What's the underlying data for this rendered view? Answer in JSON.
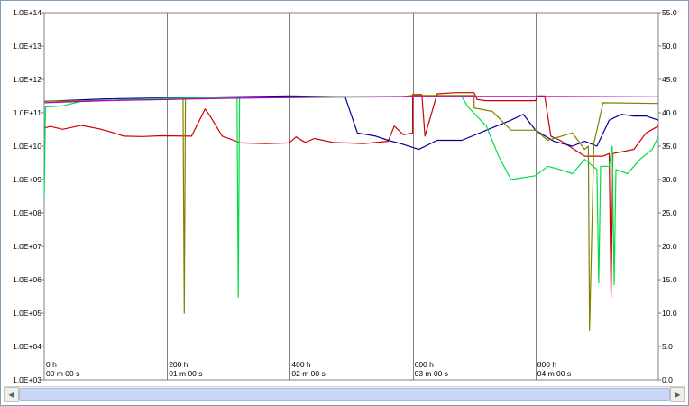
{
  "chart_data": {
    "type": "line",
    "left_axis": {
      "scale": "log",
      "ticks": [
        "1.0E+03",
        "1.0E+04",
        "1.0E+05",
        "1.0E+06",
        "1.0E+07",
        "1.0E+08",
        "1.0E+09",
        "1.0E+10",
        "1.0E+11",
        "1.0E+12",
        "1.0E+13",
        "1.0E+14"
      ],
      "range": [
        1000,
        100000000000000
      ]
    },
    "right_axis": {
      "scale": "linear",
      "ticks": [
        "0.0",
        "5.0",
        "10.0",
        "15.0",
        "20.0",
        "25.0",
        "30.0",
        "35.0",
        "40.0",
        "45.0",
        "50.0",
        "55.0"
      ],
      "range": [
        0,
        55
      ]
    },
    "x_axis": {
      "range": [
        0,
        1000
      ],
      "gridlines_at": [
        0,
        200,
        400,
        600,
        800
      ],
      "tick_labels": [
        {
          "x": 0,
          "hours": "0 h",
          "time": "00 m 00 s"
        },
        {
          "x": 200,
          "hours": "200 h",
          "time": "01 m 00 s"
        },
        {
          "x": 400,
          "hours": "400 h",
          "time": "02 m 00 s"
        },
        {
          "x": 600,
          "hours": "600 h",
          "time": "03 m 00 s"
        },
        {
          "x": 800,
          "hours": "800 h",
          "time": "04 m 00 s"
        }
      ]
    },
    "grid": "vertical-only",
    "series": [
      {
        "color": "#cc0000",
        "axis": "left",
        "points": [
          [
            0,
            35000000000.0
          ],
          [
            10,
            39000000000.0
          ],
          [
            30,
            32000000000.0
          ],
          [
            60,
            42000000000.0
          ],
          [
            90,
            33000000000.0
          ],
          [
            110,
            26000000000.0
          ],
          [
            130,
            20000000000.0
          ],
          [
            160,
            19500000000.0
          ],
          [
            190,
            20500000000.0
          ],
          [
            240,
            20000000000.0
          ],
          [
            262,
            130000000000.0
          ],
          [
            270,
            80000000000.0
          ],
          [
            290,
            20000000000.0
          ],
          [
            320,
            12500000000.0
          ],
          [
            360,
            12000000000.0
          ],
          [
            399,
            12500000000.0
          ],
          [
            410,
            19000000000.0
          ],
          [
            425,
            13000000000.0
          ],
          [
            440,
            17000000000.0
          ],
          [
            470,
            13000000000.0
          ],
          [
            520,
            12000000000.0
          ],
          [
            560,
            14000000000.0
          ],
          [
            570,
            40000000000.0
          ],
          [
            585,
            22000000000.0
          ],
          [
            600,
            25000000000.0
          ],
          [
            600,
            350000000000.0
          ],
          [
            615,
            350000000000.0
          ],
          [
            620,
            20000000000.0
          ],
          [
            640,
            370000000000.0
          ],
          [
            670,
            400000000000.0
          ],
          [
            700,
            400000000000.0
          ],
          [
            705,
            250000000000.0
          ],
          [
            720,
            230000000000.0
          ],
          [
            800,
            230000000000.0
          ],
          [
            803,
            320000000000.0
          ],
          [
            815,
            320000000000.0
          ],
          [
            825,
            20000000000.0
          ],
          [
            840,
            15000000000.0
          ],
          [
            880,
            5000000000.0
          ],
          [
            910,
            5000000000.0
          ],
          [
            920,
            6000000000.0
          ],
          [
            923,
            300000.0
          ],
          [
            926,
            6000000000.0
          ],
          [
            960,
            8000000000.0
          ],
          [
            980,
            25000000000.0
          ],
          [
            1000,
            40000000000.0
          ]
        ]
      },
      {
        "color": "#000099",
        "axis": "left",
        "points": [
          [
            0,
            220000000000.0
          ],
          [
            100,
            260000000000.0
          ],
          [
            300,
            300000000000.0
          ],
          [
            400,
            320000000000.0
          ],
          [
            490,
            300000000000.0
          ],
          [
            510,
            25000000000.0
          ],
          [
            540,
            20000000000.0
          ],
          [
            560,
            15000000000.0
          ],
          [
            580,
            12000000000.0
          ],
          [
            610,
            8000000000.0
          ],
          [
            640,
            15000000000.0
          ],
          [
            680,
            15000000000.0
          ],
          [
            720,
            30000000000.0
          ],
          [
            760,
            60000000000.0
          ],
          [
            780,
            90000000000.0
          ],
          [
            800,
            30000000000.0
          ],
          [
            830,
            14000000000.0
          ],
          [
            860,
            10000000000.0
          ],
          [
            880,
            14000000000.0
          ],
          [
            900,
            10000000000.0
          ],
          [
            920,
            60000000000.0
          ],
          [
            940,
            90000000000.0
          ],
          [
            960,
            80000000000.0
          ],
          [
            980,
            80000000000.0
          ],
          [
            1000,
            60000000000.0
          ]
        ]
      },
      {
        "color": "#808000",
        "axis": "left",
        "points": [
          [
            0,
            220000000000.0
          ],
          [
            200,
            250000000000.0
          ],
          [
            226,
            260000000000.0
          ],
          [
            228,
            100000.0
          ],
          [
            230,
            270000000000.0
          ],
          [
            400,
            300000000000.0
          ],
          [
            580,
            300000000000.0
          ],
          [
            600,
            330000000000.0
          ],
          [
            700,
            330000000000.0
          ],
          [
            700,
            140000000000.0
          ],
          [
            730,
            110000000000.0
          ],
          [
            760,
            30000000000.0
          ],
          [
            800,
            30000000000.0
          ],
          [
            820,
            15000000000.0
          ],
          [
            860,
            25000000000.0
          ],
          [
            880,
            8000000000.0
          ],
          [
            886,
            10000000000.0
          ],
          [
            888,
            30000.0
          ],
          [
            895,
            12000000000.0
          ],
          [
            910,
            200000000000.0
          ],
          [
            1000,
            190000000000.0
          ]
        ]
      },
      {
        "color": "#00dd44",
        "axis": "left",
        "points": [
          [
            0,
            300000000.0
          ],
          [
            2,
            150000000000.0
          ],
          [
            30,
            160000000000.0
          ],
          [
            60,
            220000000000.0
          ],
          [
            200,
            270000000000.0
          ],
          [
            314,
            280000000000.0
          ],
          [
            316,
            300000.0
          ],
          [
            318,
            280000000000.0
          ],
          [
            600,
            300000000000.0
          ],
          [
            680,
            300000000000.0
          ],
          [
            690,
            150000000000.0
          ],
          [
            720,
            40000000000.0
          ],
          [
            740,
            5000000000.0
          ],
          [
            760,
            1000000000.0
          ],
          [
            800,
            1300000000.0
          ],
          [
            820,
            2500000000.0
          ],
          [
            840,
            2000000000.0
          ],
          [
            860,
            1500000000.0
          ],
          [
            880,
            4000000000.0
          ],
          [
            900,
            2000000000.0
          ],
          [
            903,
            800000.0
          ],
          [
            906,
            2500000000.0
          ],
          [
            920,
            2500000000.0
          ],
          [
            925,
            10000000000.0
          ],
          [
            928,
            700000.0
          ],
          [
            931,
            2000000000.0
          ],
          [
            950,
            1500000000.0
          ],
          [
            970,
            4000000000.0
          ],
          [
            990,
            8000000000.0
          ],
          [
            1000,
            20000000000.0
          ]
        ]
      },
      {
        "color": "#bb00bb",
        "axis": "left",
        "points": [
          [
            0,
            200000000000.0
          ],
          [
            100,
            230000000000.0
          ],
          [
            300,
            270000000000.0
          ],
          [
            500,
            300000000000.0
          ],
          [
            600,
            310000000000.0
          ],
          [
            800,
            310000000000.0
          ],
          [
            1000,
            300000000000.0
          ]
        ]
      }
    ]
  },
  "scrollbar": {
    "left_icon": "scroll-left-arrow-icon",
    "right_icon": "scroll-right-arrow-icon",
    "left_glyph": "◀",
    "right_glyph": "▶"
  },
  "colors": {
    "plot_background": "#ffffff",
    "gridline": "#808080",
    "window_background": "#ece9d8"
  }
}
